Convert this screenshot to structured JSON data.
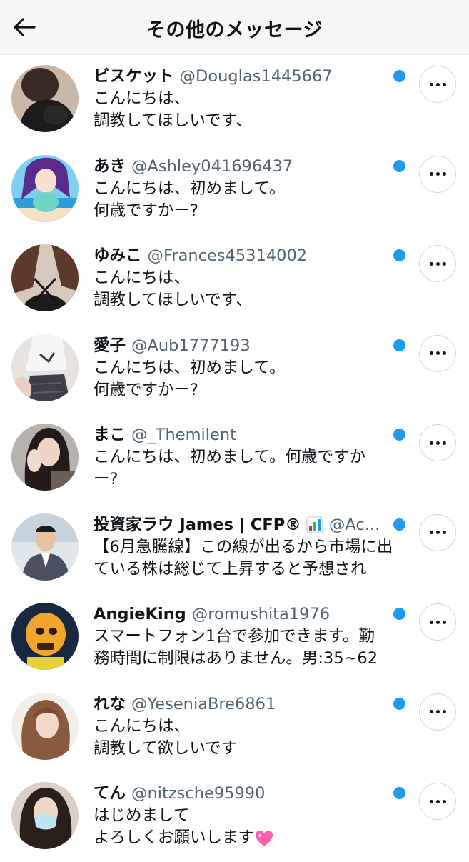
{
  "header": {
    "title": "その他のメッセージ",
    "back_icon": "arrow-left-icon"
  },
  "accent_color": "#1d9bf0",
  "messages": [
    {
      "name": "ビスケット",
      "handle": "@Douglas1445667",
      "lines": [
        "こんにちは、",
        "調教してほしいです、"
      ],
      "unread": true
    },
    {
      "name": "あき",
      "handle": "@Ashley041696437",
      "lines": [
        "こんにちは、初めまして。",
        "何歳ですかー?"
      ],
      "unread": true
    },
    {
      "name": "ゆみこ",
      "handle": "@Frances45314002",
      "lines": [
        "こんにちは、",
        "調教してほしいです、"
      ],
      "unread": true
    },
    {
      "name": "愛子",
      "handle": "@Aub1777193",
      "lines": [
        "こんにちは、初めまして。",
        "何歳ですかー?"
      ],
      "unread": true
    },
    {
      "name": "まこ",
      "handle": "@_Themilent",
      "lines": [
        "こんにちは、初めまして。何歳ですか",
        "ー?"
      ],
      "unread": true
    },
    {
      "name": "投資家ラウ James | CFP®",
      "name_emoji": "bar-chart-icon",
      "handle": "@Ac...",
      "lines": [
        "【6月急騰線】この線が出るから市場に出",
        "ている株は総じて上昇すると予想され"
      ],
      "unread": true
    },
    {
      "name": "AngieKing",
      "handle": "@romushita1976",
      "lines": [
        "スマートフォン1台で参加できます。勤",
        "務時間に制限はありません。男:35~62"
      ],
      "unread": true
    },
    {
      "name": "れな",
      "handle": "@YeseniaBre6861",
      "lines": [
        "こんにちは、",
        "調教して欲しいです"
      ],
      "unread": true
    },
    {
      "name": "てん",
      "handle": "@nitzsche95990",
      "lines": [
        "はじめまして",
        "よろしくお願いします"
      ],
      "line_emoji": "sparkling-heart-icon",
      "unread": true
    }
  ]
}
